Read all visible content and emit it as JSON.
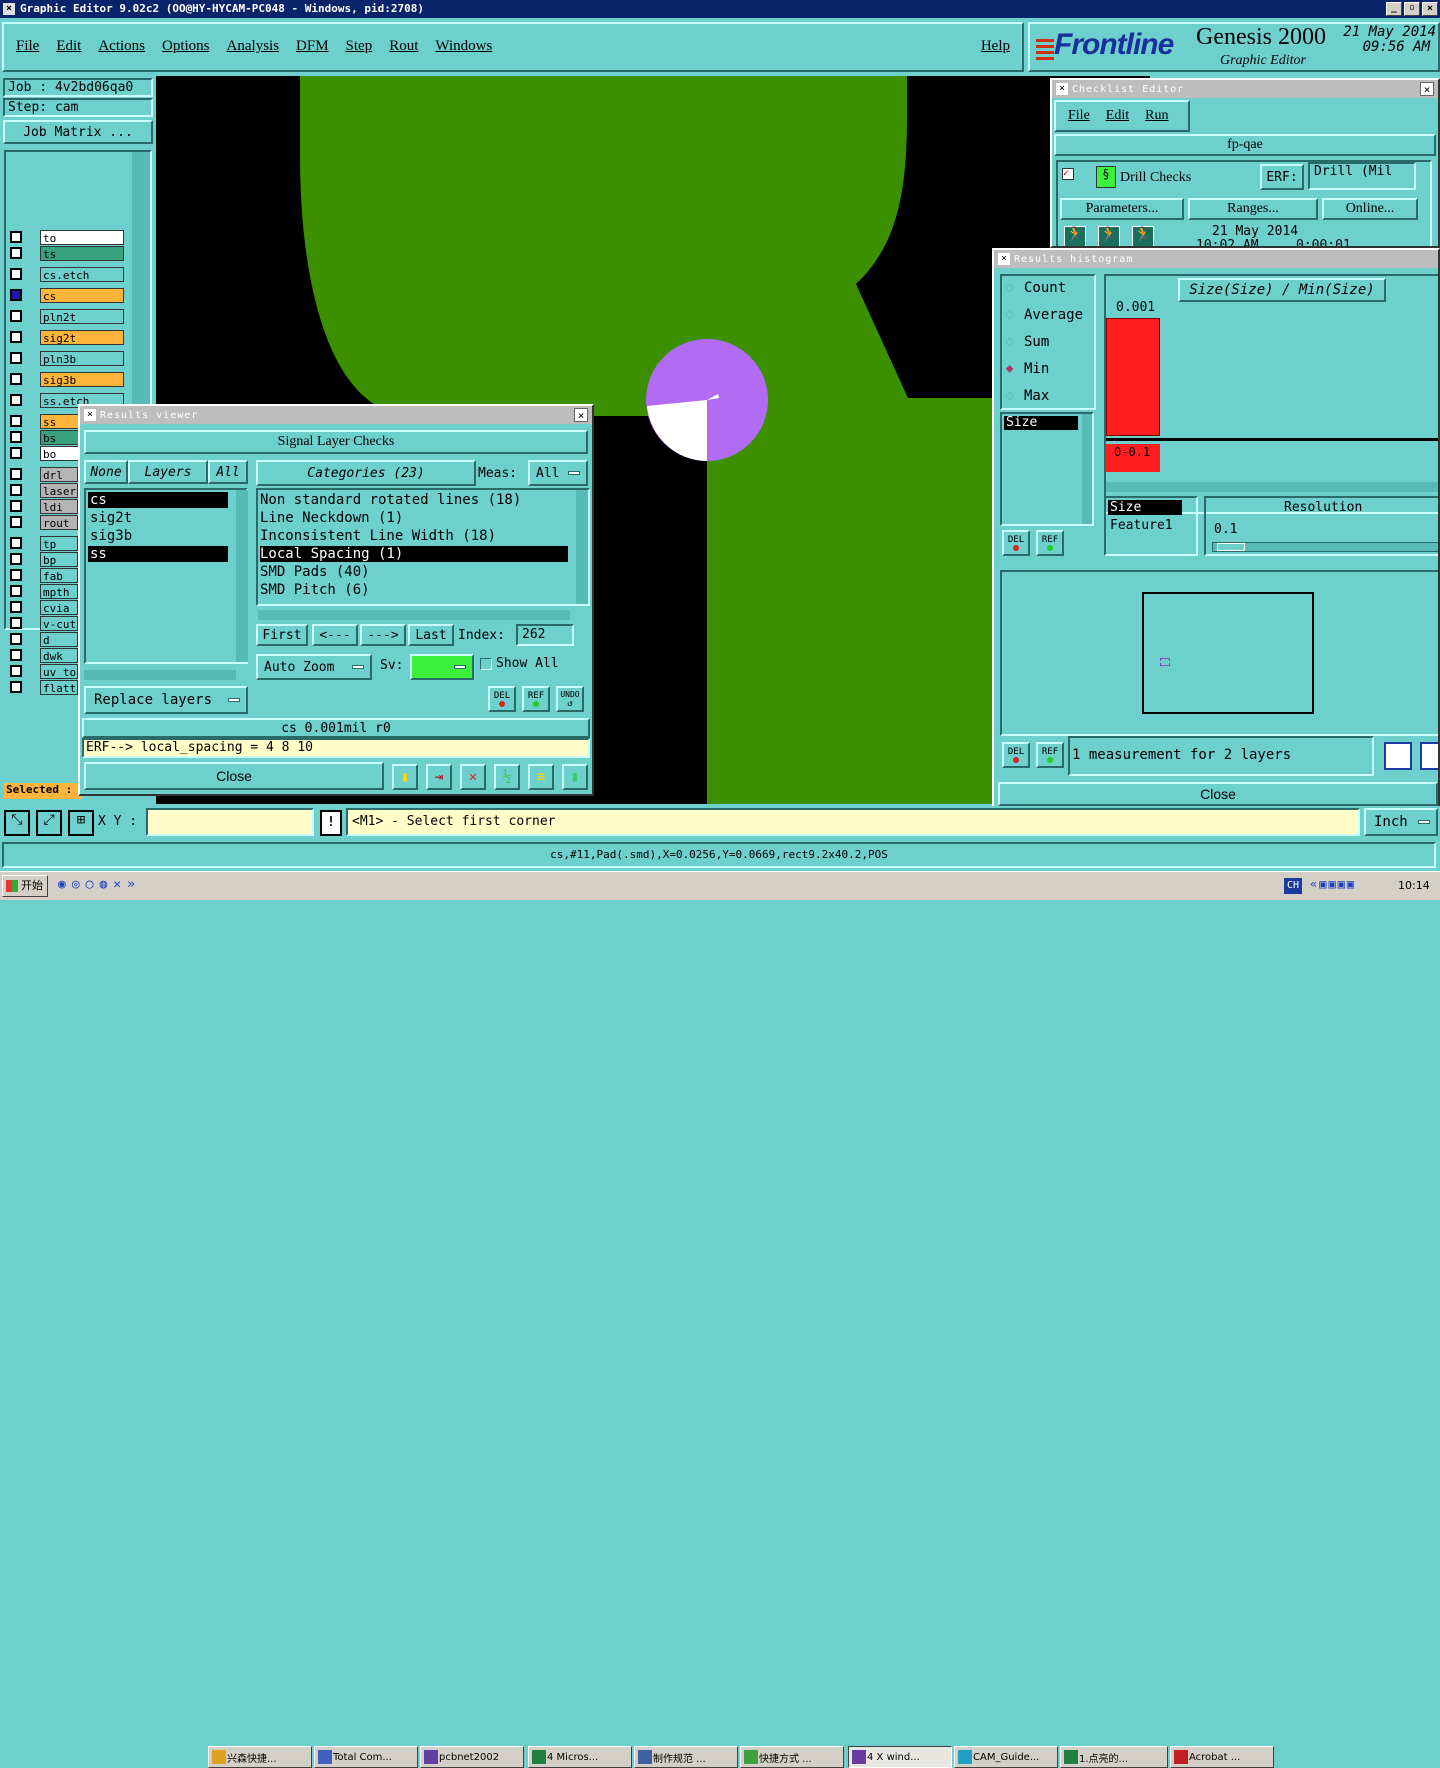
{
  "window": {
    "title": "Graphic Editor 9.02c2 (OO@HY-HYCAM-PC048 - Windows, pid:2708)"
  },
  "menubar": {
    "items": [
      "File",
      "Edit",
      "Actions",
      "Options",
      "Analysis",
      "DFM",
      "Step",
      "Rout",
      "Windows"
    ],
    "help": "Help"
  },
  "header": {
    "brand": "Frontline",
    "product": "Genesis 2000",
    "subtitle": "Graphic Editor",
    "date": "21 May 2014",
    "time": "09:56 AM"
  },
  "job": {
    "job": "Job : 4v2bd06qa0",
    "step": "Step: cam",
    "matrix": "Job Matrix ..."
  },
  "layers": [
    {
      "name": "to",
      "color": "#ffffff"
    },
    {
      "name": "ts",
      "color": "#3aa17e"
    },
    {
      "name": "cs.etch",
      "color": "#6ed0cd"
    },
    {
      "name": "cs",
      "color": "#ffb43c"
    },
    {
      "name": "pln2t",
      "color": "#6ed0cd"
    },
    {
      "name": "sig2t",
      "color": "#ffb43c"
    },
    {
      "name": "pln3b",
      "color": "#6ed0cd"
    },
    {
      "name": "sig3b",
      "color": "#ffb43c"
    },
    {
      "name": "ss.etch",
      "color": "#6ed0cd"
    },
    {
      "name": "ss",
      "color": "#ffb43c"
    },
    {
      "name": "bs",
      "color": "#3aa17e"
    },
    {
      "name": "bo",
      "color": "#ffffff"
    },
    {
      "name": "drl",
      "color": "#b4b4b4"
    },
    {
      "name": "laser",
      "color": "#b4b4b4"
    },
    {
      "name": "ldi",
      "color": "#b4b4b4"
    },
    {
      "name": "rout",
      "color": "#b4b4b4"
    },
    {
      "name": "tp",
      "color": "#6ed0cd"
    },
    {
      "name": "bp",
      "color": "#6ed0cd"
    },
    {
      "name": "fab",
      "color": "#6ed0cd"
    },
    {
      "name": "mpth",
      "color": "#6ed0cd"
    },
    {
      "name": "cvia",
      "color": "#6ed0cd"
    },
    {
      "name": "v-cut",
      "color": "#6ed0cd"
    },
    {
      "name": "d",
      "color": "#6ed0cd"
    },
    {
      "name": "dwk",
      "color": "#6ed0cd"
    },
    {
      "name": "uv_to",
      "color": "#6ed0cd"
    },
    {
      "name": "flatt",
      "color": "#6ed0cd"
    }
  ],
  "selected_label": "Selected :",
  "results_viewer": {
    "title": "Results viewer",
    "header": "Signal Layer Checks",
    "none": "None",
    "layers": "Layers",
    "all": "All",
    "layer_list": [
      "cs",
      "sig2t",
      "sig3b",
      "ss"
    ],
    "categories_label": "Categories (23)",
    "meas_label": "Meas:",
    "meas_value": "All",
    "categories": [
      "Non standard rotated lines (18)",
      "Line Neckdown (1)",
      "Inconsistent Line Width (18)",
      "Local Spacing (1)",
      "SMD Pads (40)",
      "SMD Pitch (6)"
    ],
    "nav": {
      "first": "First",
      "prev": "<---",
      "next": "--->",
      "last": "Last",
      "index_label": "Index:",
      "index_value": "262"
    },
    "auto_zoom": "Auto Zoom",
    "sv_label": "Sv:",
    "show_all": "Show All",
    "replace_layers": "Replace layers",
    "del": "DEL",
    "ref": "REF",
    "undo": "UNDO",
    "info": "cs 0.001mil  r0",
    "erf": "ERF--> local_spacing = 4 8 10",
    "close": "Close"
  },
  "checklist": {
    "title": "Checklist Editor",
    "menu": [
      "File",
      "Edit",
      "Run"
    ],
    "name": "fp-qae",
    "check": "Drill Checks",
    "erf_label": "ERF:",
    "erf_value": "Drill (Mil",
    "parameters": "Parameters...",
    "ranges": "Ranges...",
    "online": "Online...",
    "date": "21 May 2014",
    "time": "10:02 AM",
    "elapsed": "0:00:01"
  },
  "histogram": {
    "title": "Results histogram",
    "modes": [
      "Count",
      "Average",
      "Sum",
      "Min",
      "Max"
    ],
    "selected_mode": "Min",
    "size_item": "Size",
    "formula": "Size(Size) / Min(Size)",
    "chart_data": {
      "type": "bar",
      "categories": [
        "0-0.1"
      ],
      "values": [
        1
      ],
      "value_labels": [
        "0.001"
      ]
    },
    "feature_items": [
      "Size",
      "Feature1"
    ],
    "resolution_label": "Resolution",
    "resolution_value": "0.1",
    "measurement": "1 measurement for 2 layers",
    "close": "Close",
    "del": "DEL",
    "ref": "REF"
  },
  "bottom": {
    "xy_label": "X Y :",
    "prompt": "<M1> - Select first corner",
    "units": "Inch",
    "status": "cs,#11,Pad(.smd),X=0.0256,Y=0.0669,rect9.2x40.2,POS"
  },
  "taskbar": {
    "start": "开始",
    "items": [
      "兴森快捷...",
      "Total Com...",
      "pcbnet2002",
      "4 Micros...",
      "制作规范 ...",
      "快捷方式 ...",
      "4 X wind...",
      "CAM_Guide...",
      "1.点亮的...",
      "Acrobat ..."
    ],
    "lang": "CH",
    "clock": "10:14"
  }
}
